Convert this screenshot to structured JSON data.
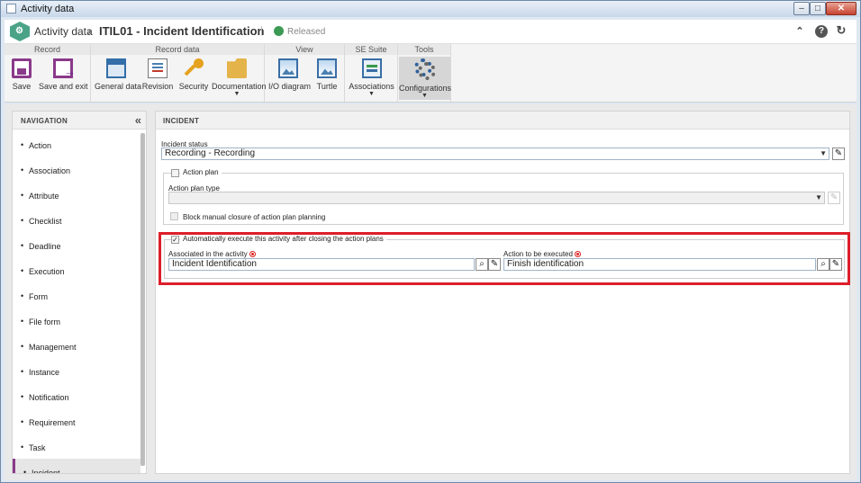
{
  "window": {
    "title": "Activity data"
  },
  "header": {
    "breadcrumb_root": "Activity data",
    "title": "ITIL01 - Incident Identification",
    "status": "Released"
  },
  "ribbon": {
    "groups": {
      "record": "Record",
      "record_data": "Record data",
      "view": "View",
      "se_suite": "SE Suite",
      "tools": "Tools"
    },
    "buttons": {
      "save": "Save",
      "save_exit": "Save and exit",
      "general_data": "General data",
      "revision": "Revision",
      "security": "Security",
      "documentation": "Documentation",
      "io_diagram": "I/O diagram",
      "turtle": "Turtle",
      "associations": "Associations",
      "configurations": "Configurations"
    }
  },
  "navigation": {
    "title": "NAVIGATION",
    "items": [
      "Action",
      "Association",
      "Attribute",
      "Checklist",
      "Deadline",
      "Execution",
      "Form",
      "File form",
      "Management",
      "Instance",
      "Notification",
      "Requirement",
      "Task",
      "Incident"
    ],
    "active": "Incident"
  },
  "incident": {
    "title": "INCIDENT",
    "status_label": "Incident status",
    "status_value": "Recording - Recording",
    "action_plan": {
      "legend": "Action plan",
      "type_label": "Action plan type",
      "type_value": "",
      "block_label": "Block manual closure of action plan planning"
    },
    "auto_exec": {
      "legend": "Automatically execute this activity after closing the action plans",
      "assoc_label": "Associated in the activity",
      "assoc_value": "Incident Identification",
      "action_label": "Action to be executed",
      "action_value": "Finish identification"
    }
  },
  "colors": {
    "highlight": "#dd1e2b",
    "accent": "#8a3a8a",
    "released": "#3c9a55"
  }
}
